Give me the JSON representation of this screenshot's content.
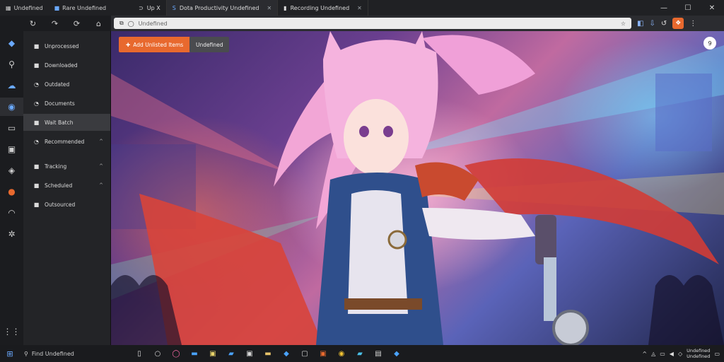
{
  "titlebar": {
    "app_name": "Undefined",
    "left_item": "Rare Undefined",
    "tabs": [
      {
        "label": "Up X",
        "active": false
      },
      {
        "label": "Dota Productivity Undefined",
        "active": true
      },
      {
        "label": "Recording Undefined",
        "active": false
      }
    ],
    "controls": [
      "—",
      "☐",
      "✕"
    ]
  },
  "toolbar": {
    "address_text": "Undefined"
  },
  "panel": {
    "items": [
      {
        "label": "Unprocessed",
        "icon": "■",
        "active": false,
        "chevron": ""
      },
      {
        "label": "Downloaded",
        "icon": "■",
        "active": false,
        "chevron": ""
      },
      {
        "label": "Outdated",
        "icon": "◔",
        "active": false,
        "chevron": ""
      },
      {
        "label": "Documents",
        "icon": "◔",
        "active": false,
        "chevron": ""
      },
      {
        "label": "Wait Batch",
        "icon": "■",
        "active": true,
        "chevron": ""
      },
      {
        "label": "Recommended",
        "icon": "◔",
        "active": false,
        "chevron": "^"
      },
      {
        "label": "Tracking",
        "icon": "■",
        "active": false,
        "chevron": "^"
      },
      {
        "label": "Scheduled",
        "icon": "■",
        "active": false,
        "chevron": "^"
      },
      {
        "label": "Outsourced",
        "icon": "■",
        "active": false,
        "chevron": ""
      }
    ]
  },
  "content": {
    "primary_button": "Add Unlisted Items",
    "secondary_button": "Undefined",
    "badge": "9"
  },
  "taskbar": {
    "search_text": "Find Undefined",
    "clock_time": "Undefined",
    "clock_date": "Undefined"
  },
  "colors": {
    "accent": "#e8692e",
    "titlebar": "#202124",
    "panel": "#232427"
  }
}
